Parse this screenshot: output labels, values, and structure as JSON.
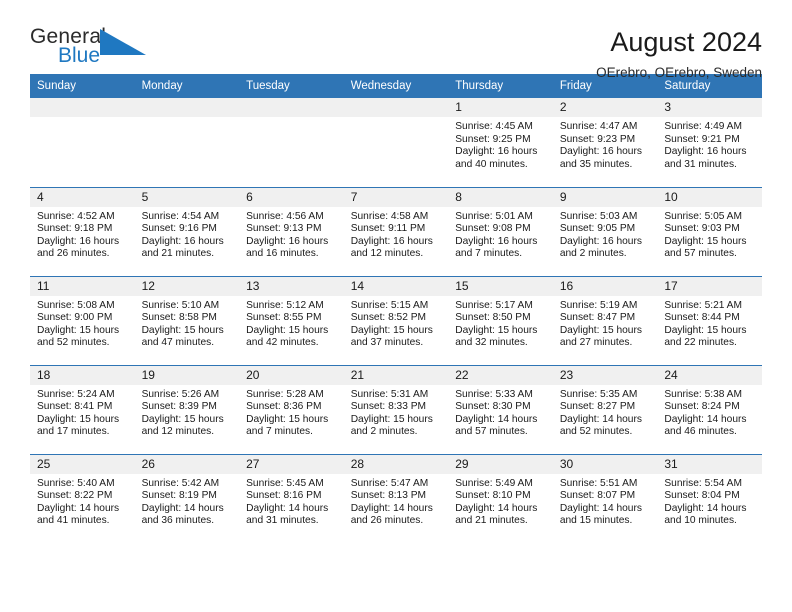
{
  "brand": {
    "name_dark": "General",
    "name_blue": "Blue",
    "triangle_icon": "blue-triangle-icon",
    "accent_color": "#1f78c1"
  },
  "header": {
    "title": "August 2024",
    "subtitle": "OErebro, OErebro, Sweden"
  },
  "theme": {
    "header_blue": "#2f75b5",
    "daynum_gray": "#f0f0f0",
    "text": "#1a1a1a"
  },
  "weekday_headers": [
    "Sunday",
    "Monday",
    "Tuesday",
    "Wednesday",
    "Thursday",
    "Friday",
    "Saturday"
  ],
  "weeks": [
    [
      {
        "day": "",
        "lines": []
      },
      {
        "day": "",
        "lines": []
      },
      {
        "day": "",
        "lines": []
      },
      {
        "day": "",
        "lines": []
      },
      {
        "day": "1",
        "lines": [
          "Sunrise: 4:45 AM",
          "Sunset: 9:25 PM",
          "Daylight: 16 hours",
          "and 40 minutes."
        ]
      },
      {
        "day": "2",
        "lines": [
          "Sunrise: 4:47 AM",
          "Sunset: 9:23 PM",
          "Daylight: 16 hours",
          "and 35 minutes."
        ]
      },
      {
        "day": "3",
        "lines": [
          "Sunrise: 4:49 AM",
          "Sunset: 9:21 PM",
          "Daylight: 16 hours",
          "and 31 minutes."
        ]
      }
    ],
    [
      {
        "day": "4",
        "lines": [
          "Sunrise: 4:52 AM",
          "Sunset: 9:18 PM",
          "Daylight: 16 hours",
          "and 26 minutes."
        ]
      },
      {
        "day": "5",
        "lines": [
          "Sunrise: 4:54 AM",
          "Sunset: 9:16 PM",
          "Daylight: 16 hours",
          "and 21 minutes."
        ]
      },
      {
        "day": "6",
        "lines": [
          "Sunrise: 4:56 AM",
          "Sunset: 9:13 PM",
          "Daylight: 16 hours",
          "and 16 minutes."
        ]
      },
      {
        "day": "7",
        "lines": [
          "Sunrise: 4:58 AM",
          "Sunset: 9:11 PM",
          "Daylight: 16 hours",
          "and 12 minutes."
        ]
      },
      {
        "day": "8",
        "lines": [
          "Sunrise: 5:01 AM",
          "Sunset: 9:08 PM",
          "Daylight: 16 hours",
          "and 7 minutes."
        ]
      },
      {
        "day": "9",
        "lines": [
          "Sunrise: 5:03 AM",
          "Sunset: 9:05 PM",
          "Daylight: 16 hours",
          "and 2 minutes."
        ]
      },
      {
        "day": "10",
        "lines": [
          "Sunrise: 5:05 AM",
          "Sunset: 9:03 PM",
          "Daylight: 15 hours",
          "and 57 minutes."
        ]
      }
    ],
    [
      {
        "day": "11",
        "lines": [
          "Sunrise: 5:08 AM",
          "Sunset: 9:00 PM",
          "Daylight: 15 hours",
          "and 52 minutes."
        ]
      },
      {
        "day": "12",
        "lines": [
          "Sunrise: 5:10 AM",
          "Sunset: 8:58 PM",
          "Daylight: 15 hours",
          "and 47 minutes."
        ]
      },
      {
        "day": "13",
        "lines": [
          "Sunrise: 5:12 AM",
          "Sunset: 8:55 PM",
          "Daylight: 15 hours",
          "and 42 minutes."
        ]
      },
      {
        "day": "14",
        "lines": [
          "Sunrise: 5:15 AM",
          "Sunset: 8:52 PM",
          "Daylight: 15 hours",
          "and 37 minutes."
        ]
      },
      {
        "day": "15",
        "lines": [
          "Sunrise: 5:17 AM",
          "Sunset: 8:50 PM",
          "Daylight: 15 hours",
          "and 32 minutes."
        ]
      },
      {
        "day": "16",
        "lines": [
          "Sunrise: 5:19 AM",
          "Sunset: 8:47 PM",
          "Daylight: 15 hours",
          "and 27 minutes."
        ]
      },
      {
        "day": "17",
        "lines": [
          "Sunrise: 5:21 AM",
          "Sunset: 8:44 PM",
          "Daylight: 15 hours",
          "and 22 minutes."
        ]
      }
    ],
    [
      {
        "day": "18",
        "lines": [
          "Sunrise: 5:24 AM",
          "Sunset: 8:41 PM",
          "Daylight: 15 hours",
          "and 17 minutes."
        ]
      },
      {
        "day": "19",
        "lines": [
          "Sunrise: 5:26 AM",
          "Sunset: 8:39 PM",
          "Daylight: 15 hours",
          "and 12 minutes."
        ]
      },
      {
        "day": "20",
        "lines": [
          "Sunrise: 5:28 AM",
          "Sunset: 8:36 PM",
          "Daylight: 15 hours",
          "and 7 minutes."
        ]
      },
      {
        "day": "21",
        "lines": [
          "Sunrise: 5:31 AM",
          "Sunset: 8:33 PM",
          "Daylight: 15 hours",
          "and 2 minutes."
        ]
      },
      {
        "day": "22",
        "lines": [
          "Sunrise: 5:33 AM",
          "Sunset: 8:30 PM",
          "Daylight: 14 hours",
          "and 57 minutes."
        ]
      },
      {
        "day": "23",
        "lines": [
          "Sunrise: 5:35 AM",
          "Sunset: 8:27 PM",
          "Daylight: 14 hours",
          "and 52 minutes."
        ]
      },
      {
        "day": "24",
        "lines": [
          "Sunrise: 5:38 AM",
          "Sunset: 8:24 PM",
          "Daylight: 14 hours",
          "and 46 minutes."
        ]
      }
    ],
    [
      {
        "day": "25",
        "lines": [
          "Sunrise: 5:40 AM",
          "Sunset: 8:22 PM",
          "Daylight: 14 hours",
          "and 41 minutes."
        ]
      },
      {
        "day": "26",
        "lines": [
          "Sunrise: 5:42 AM",
          "Sunset: 8:19 PM",
          "Daylight: 14 hours",
          "and 36 minutes."
        ]
      },
      {
        "day": "27",
        "lines": [
          "Sunrise: 5:45 AM",
          "Sunset: 8:16 PM",
          "Daylight: 14 hours",
          "and 31 minutes."
        ]
      },
      {
        "day": "28",
        "lines": [
          "Sunrise: 5:47 AM",
          "Sunset: 8:13 PM",
          "Daylight: 14 hours",
          "and 26 minutes."
        ]
      },
      {
        "day": "29",
        "lines": [
          "Sunrise: 5:49 AM",
          "Sunset: 8:10 PM",
          "Daylight: 14 hours",
          "and 21 minutes."
        ]
      },
      {
        "day": "30",
        "lines": [
          "Sunrise: 5:51 AM",
          "Sunset: 8:07 PM",
          "Daylight: 14 hours",
          "and 15 minutes."
        ]
      },
      {
        "day": "31",
        "lines": [
          "Sunrise: 5:54 AM",
          "Sunset: 8:04 PM",
          "Daylight: 14 hours",
          "and 10 minutes."
        ]
      }
    ]
  ]
}
